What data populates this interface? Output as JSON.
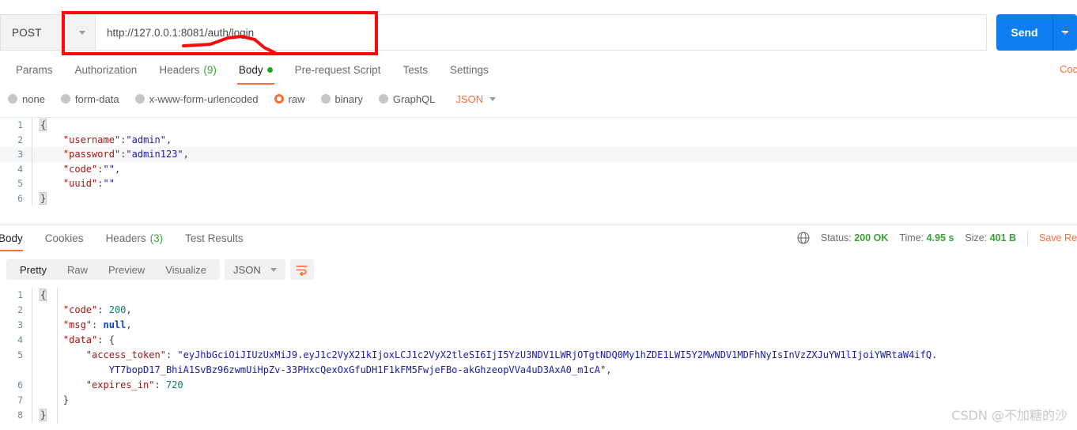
{
  "request": {
    "method": "POST",
    "url": "http://127.0.0.1:8081/auth/login",
    "send_label": "Send",
    "save_label_cut": "S",
    "code_link_cut": "Coc",
    "tabs": [
      {
        "label": "Params",
        "count": "",
        "active": false,
        "dot": false
      },
      {
        "label": "Authorization",
        "count": "",
        "active": false,
        "dot": false
      },
      {
        "label": "Headers",
        "count": "(9)",
        "active": false,
        "dot": false
      },
      {
        "label": "Body",
        "count": "",
        "active": true,
        "dot": true
      },
      {
        "label": "Pre-request Script",
        "count": "",
        "active": false,
        "dot": false
      },
      {
        "label": "Tests",
        "count": "",
        "active": false,
        "dot": false
      },
      {
        "label": "Settings",
        "count": "",
        "active": false,
        "dot": false
      }
    ],
    "body_types": [
      {
        "label": "none",
        "selected": false
      },
      {
        "label": "form-data",
        "selected": false
      },
      {
        "label": "x-www-form-urlencoded",
        "selected": false
      },
      {
        "label": "raw",
        "selected": true
      },
      {
        "label": "binary",
        "selected": false
      },
      {
        "label": "GraphQL",
        "selected": false
      }
    ],
    "raw_format": "JSON",
    "body_lines": [
      {
        "n": "1",
        "open_brace": "{",
        "highlight": false
      },
      {
        "n": "2",
        "key": "\"username\"",
        "colon": ":",
        "value": "\"admin\"",
        "comma": ",",
        "highlight": false
      },
      {
        "n": "3",
        "key": "\"password\"",
        "colon": ":",
        "value": "\"admin123\"",
        "comma": ",",
        "highlight": true
      },
      {
        "n": "4",
        "key": "\"code\"",
        "colon": ":",
        "value": "\"\"",
        "comma": ",",
        "highlight": false
      },
      {
        "n": "5",
        "key": "\"uuid\"",
        "colon": ":",
        "value": "\"\"",
        "comma": "",
        "highlight": false
      },
      {
        "n": "6",
        "close_brace": "}",
        "highlight": false
      }
    ]
  },
  "response": {
    "tabs": [
      {
        "label": "Body",
        "count": "",
        "active": true
      },
      {
        "label": "Cookies",
        "count": "",
        "active": false
      },
      {
        "label": "Headers",
        "count": "(3)",
        "active": false
      },
      {
        "label": "Test Results",
        "count": "",
        "active": false
      }
    ],
    "status": {
      "status_label": "Status:",
      "status_value": "200 OK",
      "time_label": "Time:",
      "time_value": "4.95 s",
      "size_label": "Size:",
      "size_value": "401 B",
      "save_response": "Save Re"
    },
    "view_modes": [
      {
        "label": "Pretty",
        "active": true
      },
      {
        "label": "Raw",
        "active": false
      },
      {
        "label": "Preview",
        "active": false
      },
      {
        "label": "Visualize",
        "active": false
      }
    ],
    "format": "JSON",
    "lines": {
      "l1_num": "1",
      "l1_brace": "{",
      "l2_num": "2",
      "l2_key": "\"code\"",
      "l2_val": "200",
      "l3_num": "3",
      "l3_key": "\"msg\"",
      "l3_val": "null",
      "l4_num": "4",
      "l4_key": "\"data\"",
      "l4_brace": "{",
      "l5_num": "5",
      "l5_key": "\"access_token\"",
      "l5_val_part1": "\"eyJhbGciOiJIUzUxMiJ9.eyJ1c2VyX21kIjoxLCJ1c2VyX2tleSI6IjI5YzU3NDV1LWRjOTgtNDQ0My1hZDE1LWI5Y2MwNDV1MDFhNyIsInVzZXJuYW1lIjoiYWRtaW4ifQ.",
      "l5_val_part2": "YT7bopD17_BhiA1SvBz96zwmUiHpZv-33PHxcQexOxGfuDH1F1kFM5FwjeFBo-akGhzeopVVa4uD3AxA0_m1cA\",",
      "l6_num": "6",
      "l6_key": "\"expires_in\"",
      "l6_val": "720",
      "l7_num": "7",
      "l7_brace": "}",
      "l8_num": "8",
      "l8_brace": "}"
    }
  },
  "watermark": "CSDN @不加糖的沙",
  "colors": {
    "accent_orange": "#ff6c37",
    "send_blue": "#0d7ef0",
    "status_green": "#3aa03a",
    "annotation_red": "#fb0a0a"
  }
}
